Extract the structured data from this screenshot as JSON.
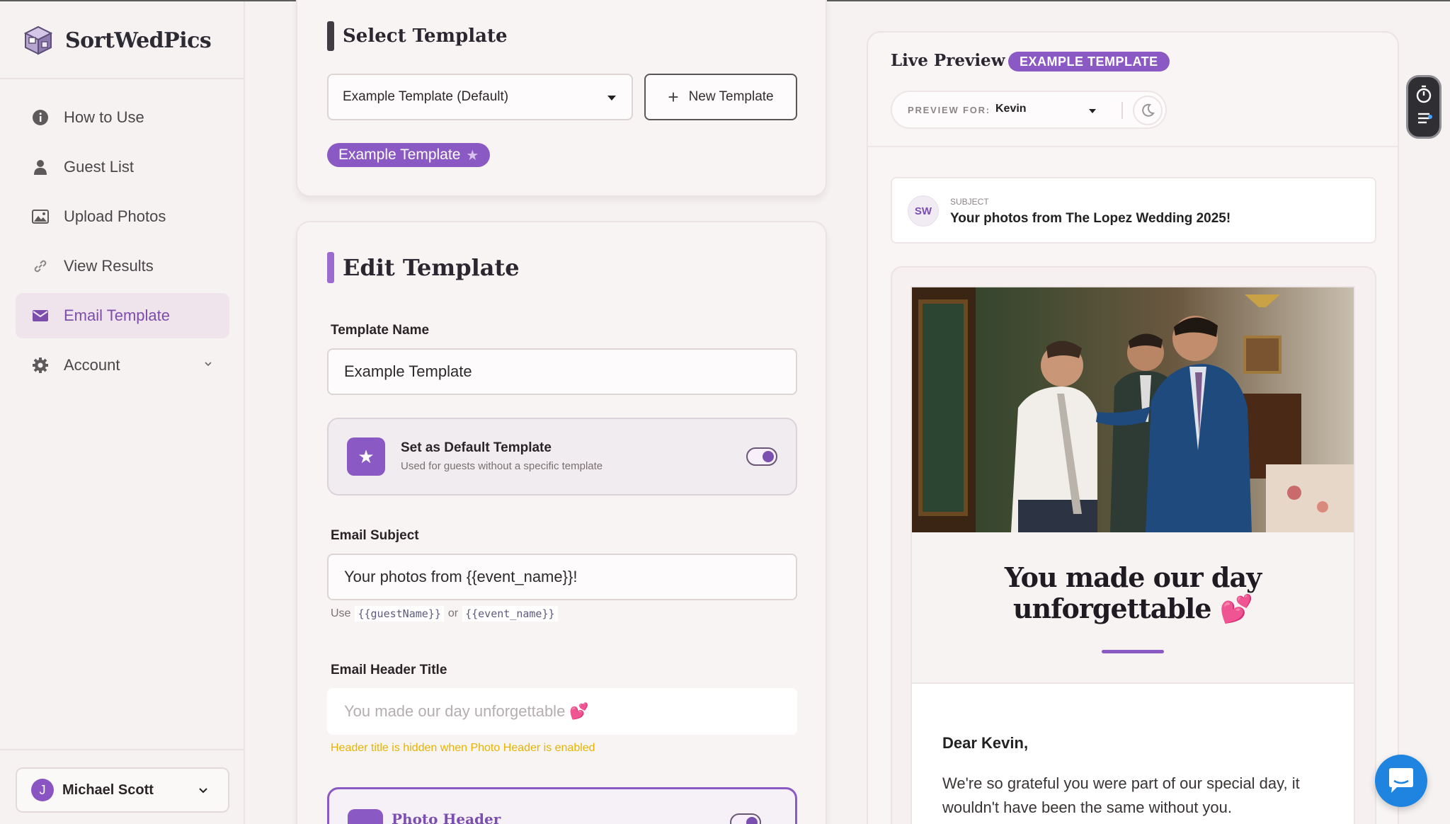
{
  "app": {
    "name": "SortWedPics"
  },
  "sidebar": {
    "items": [
      {
        "label": "How to Use",
        "icon": "info-icon"
      },
      {
        "label": "Guest List",
        "icon": "person-icon"
      },
      {
        "label": "Upload Photos",
        "icon": "photo-upload-icon"
      },
      {
        "label": "View Results",
        "icon": "link-icon"
      },
      {
        "label": "Email Template",
        "icon": "envelope-icon",
        "active": true
      },
      {
        "label": "Account",
        "icon": "gear-icon",
        "expandable": true
      }
    ],
    "user": {
      "initial": "J",
      "name": "Michael Scott"
    }
  },
  "select_template": {
    "title": "Select Template",
    "selected": "Example Template (Default)",
    "new_button": "New Template",
    "chip": "Example Template"
  },
  "edit_template": {
    "title": "Edit Template",
    "name_label": "Template Name",
    "name_value": "Example Template",
    "default_title": "Set as Default Template",
    "default_sub": "Used for guests without a specific template",
    "default_on": true,
    "subject_label": "Email Subject",
    "subject_value": "Your photos from {{event_name}}!",
    "hint_use": "Use",
    "hint_var1": "{{guestName}}",
    "hint_or": "or",
    "hint_var2": "{{event_name}}",
    "header_label": "Email Header Title",
    "header_placeholder": "You made our day unforgettable 💕",
    "header_warning": "Header title is hidden when Photo Header is enabled",
    "photo_header_label": "Photo Header"
  },
  "preview": {
    "title": "Live Preview",
    "badge": "EXAMPLE TEMPLATE",
    "preview_for_label": "PREVIEW FOR:",
    "preview_for_value": "Kevin",
    "sender_initials": "SW",
    "subject_label": "SUBJECT",
    "subject_value": "Your photos from The Lopez Wedding 2025!",
    "heading_line1": "You made our day",
    "heading_line2": "unforgettable 💕",
    "greeting": "Dear Kevin,",
    "body": "We're so grateful you were part of our special day, it wouldn't have been the same without you."
  },
  "colors": {
    "accent": "#8b59c3",
    "warning": "#e6b400",
    "chat": "#1e84e0"
  }
}
